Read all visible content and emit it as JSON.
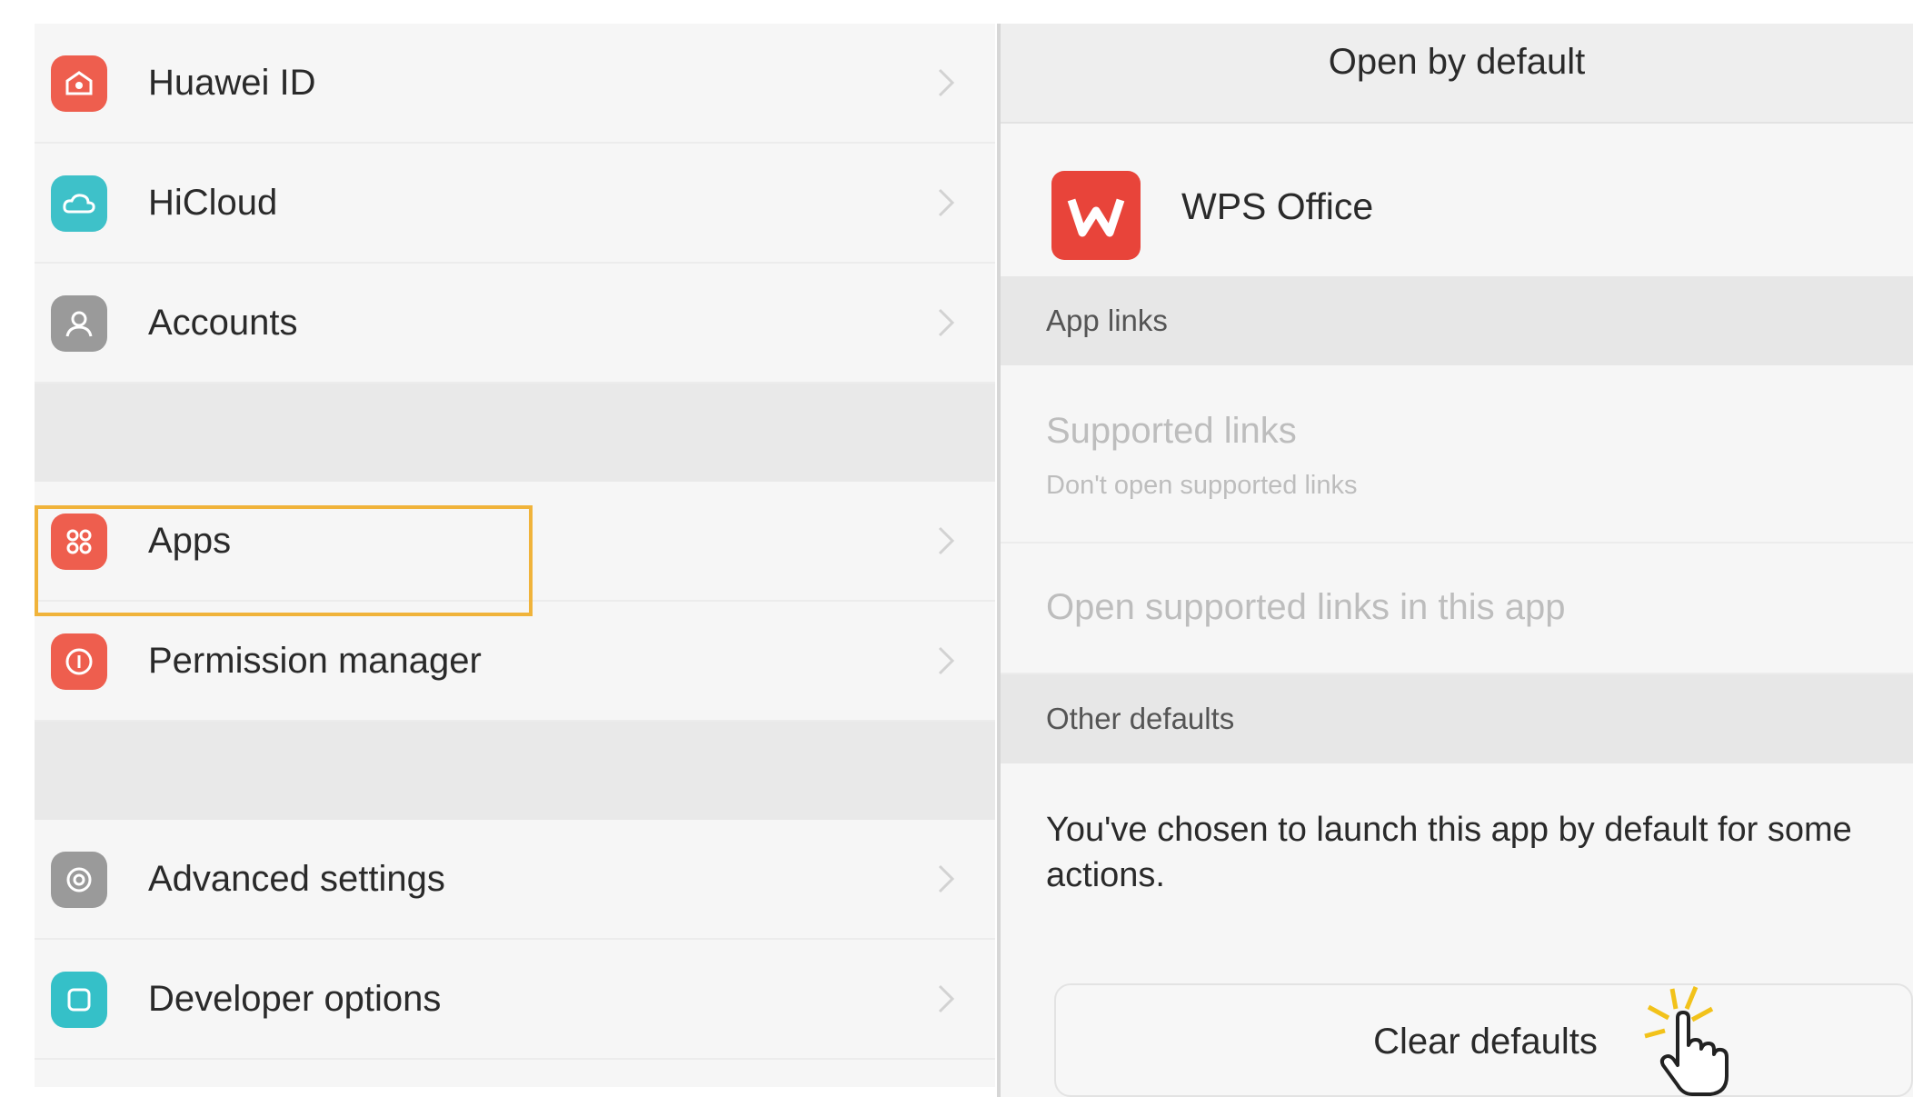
{
  "settings_list": {
    "items": [
      {
        "label": "Huawei ID",
        "icon": "huawei-id-icon",
        "color": "#ee5e4e"
      },
      {
        "label": "HiCloud",
        "icon": "cloud-icon",
        "color": "#3ec1c9"
      },
      {
        "label": "Accounts",
        "icon": "account-icon",
        "color": "#9a9a9a"
      },
      {
        "label": "Apps",
        "icon": "apps-grid-icon",
        "color": "#ee5e4e"
      },
      {
        "label": "Permission manager",
        "icon": "permission-icon",
        "color": "#ee5e4e"
      },
      {
        "label": "Advanced settings",
        "icon": "gear-icon",
        "color": "#9a9a9a"
      },
      {
        "label": "Developer options",
        "icon": "developer-icon",
        "color": "#35c0c8"
      }
    ],
    "selected": "Apps",
    "highlight_color": "#f0b33a"
  },
  "detail": {
    "title": "Open by default",
    "app_name": "WPS Office",
    "app_icon_color": "#e8443a",
    "sections": {
      "app_links": "App links",
      "other_defaults": "Other defaults"
    },
    "supported_links": {
      "label": "Supported links",
      "value": "Don't open supported links"
    },
    "open_supported": "Open supported links in this app",
    "defaults_message": "You've chosen to launch this app by default for some actions.",
    "clear_button": "Clear defaults"
  }
}
